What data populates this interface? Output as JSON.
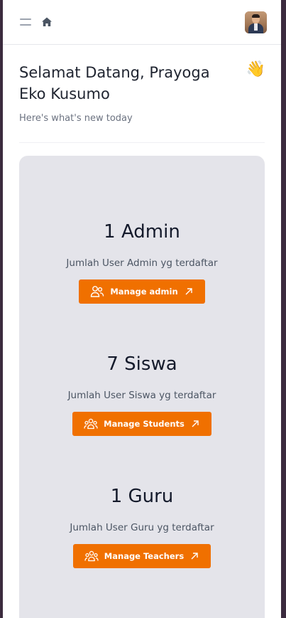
{
  "topbar": {
    "menu_icon": "hamburger-icon",
    "home_icon": "home-icon",
    "avatar_icon": "user-avatar"
  },
  "greeting": {
    "title": "Selamat Datang, Prayoga Eko Kusumo",
    "emoji": "👋",
    "subtitle": "Here's what's new today"
  },
  "stats": [
    {
      "value": "1 Admin",
      "description": "Jumlah User Admin yg terdaftar",
      "button_label": "Manage admin",
      "icon": "users-icon"
    },
    {
      "value": "7 Siswa",
      "description": "Jumlah User Siswa yg terdaftar",
      "button_label": "Manage Students",
      "icon": "users-group-icon"
    },
    {
      "value": "1 Guru",
      "description": "Jumlah User Guru yg terdaftar",
      "button_label": "Manage Teachers",
      "icon": "users-group-icon"
    }
  ],
  "colors": {
    "accent": "#f07000",
    "card_background": "#e4e4ea",
    "frame": "#3b2b3e"
  }
}
